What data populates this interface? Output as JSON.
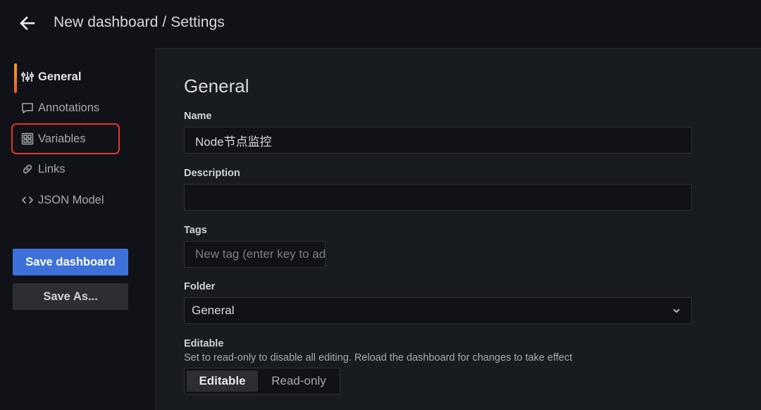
{
  "header": {
    "title": "New dashboard / Settings",
    "back_icon": "arrow-left-icon"
  },
  "sidebar": {
    "items": [
      {
        "label": "General",
        "icon": "sliders-icon",
        "active": true
      },
      {
        "label": "Annotations",
        "icon": "comment-icon"
      },
      {
        "label": "Variables",
        "icon": "calculator-icon",
        "highlighted": true
      },
      {
        "label": "Links",
        "icon": "link-icon"
      },
      {
        "label": "JSON Model",
        "icon": "code-icon"
      }
    ],
    "save_label": "Save dashboard",
    "save_as_label": "Save As..."
  },
  "general": {
    "title": "General",
    "name_label": "Name",
    "name_value": "Node节点监控",
    "description_label": "Description",
    "description_value": "",
    "tags_label": "Tags",
    "tags_placeholder": "New tag (enter key to add)",
    "folder_label": "Folder",
    "folder_value": "General",
    "editable_label": "Editable",
    "editable_description": "Set to read-only to disable all editing. Reload the dashboard for changes to take effect",
    "editable_options": [
      "Editable",
      "Read-only"
    ],
    "editable_selected": "Editable"
  },
  "colors": {
    "primary": "#3d71d9",
    "highlight_outline": "#e5362a",
    "active_accent": "#f9a01f"
  }
}
